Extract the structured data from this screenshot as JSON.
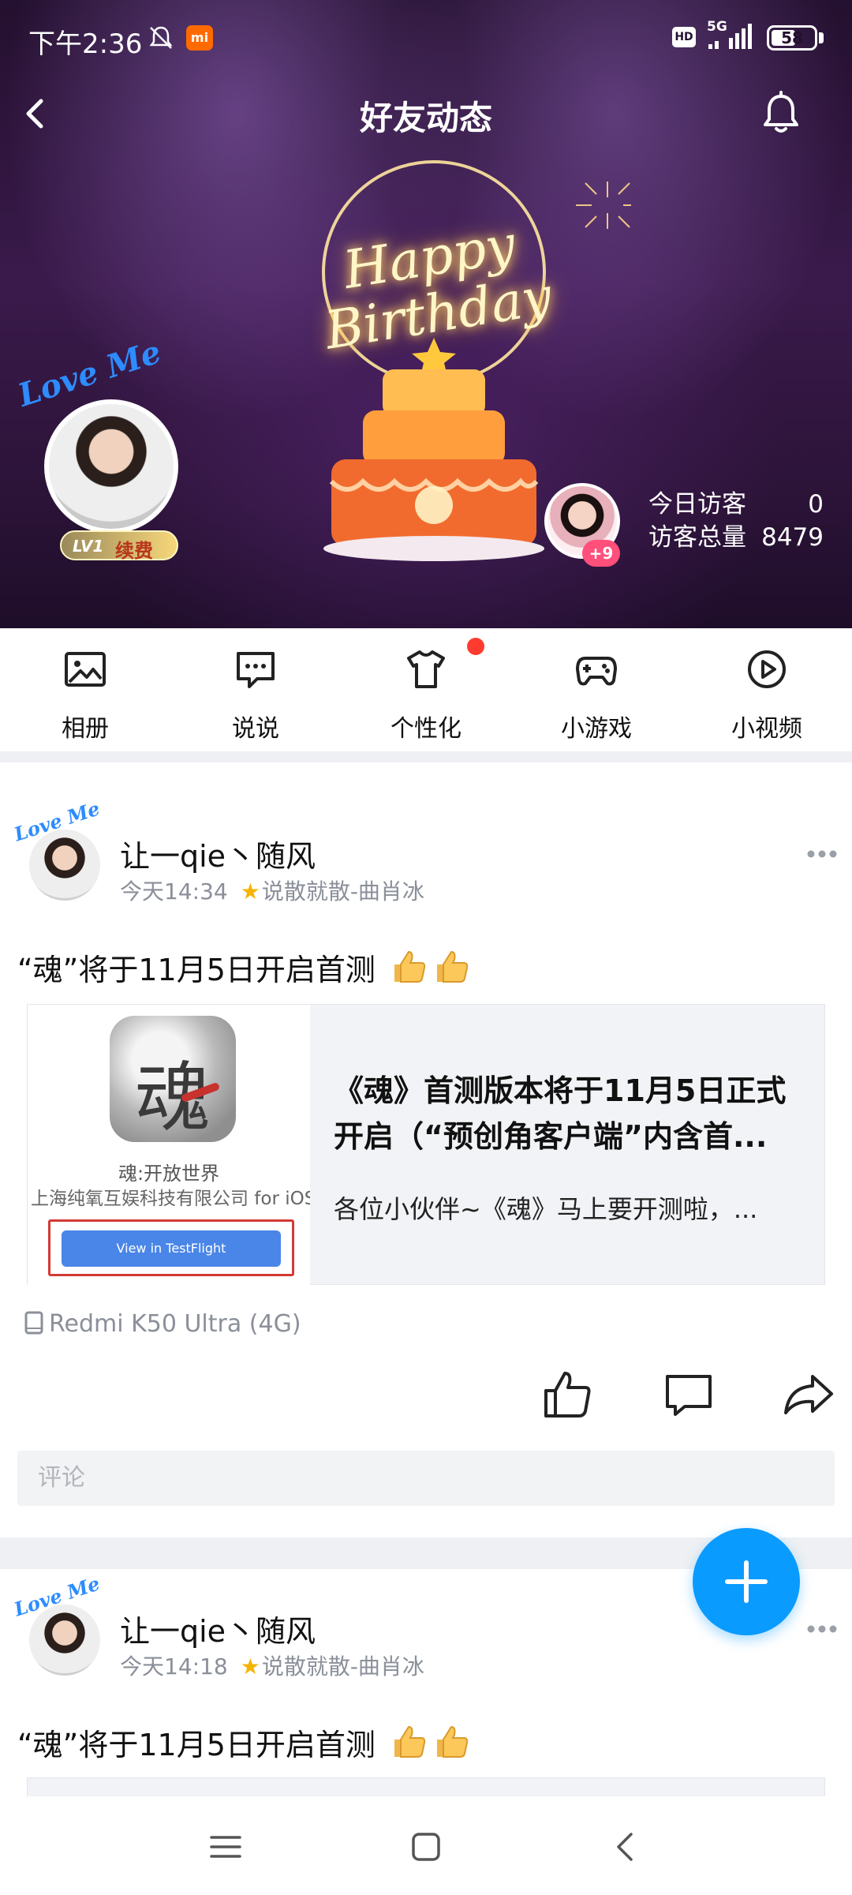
{
  "status_bar": {
    "time": "下午2:36",
    "network": "5G",
    "battery": "58",
    "battery_fraction": 0.58
  },
  "header": {
    "title": "好友动态"
  },
  "hero": {
    "banner_text_line1": "Happy",
    "banner_text_line2": "Birthday",
    "owner_level": "LV1",
    "owner_renew": "续费",
    "owner_tag": "Love Me",
    "visitor_extra": "+9",
    "stats": {
      "today_label": "今日访客",
      "today_value": "0",
      "total_label": "访客总量",
      "total_value": "8479"
    }
  },
  "shortcuts": [
    {
      "label": "相册",
      "icon": "photo-album-icon"
    },
    {
      "label": "说说",
      "icon": "chat-bubble-icon"
    },
    {
      "label": "个性化",
      "icon": "tshirt-icon"
    },
    {
      "label": "小游戏",
      "icon": "gamepad-icon"
    },
    {
      "label": "小视频",
      "icon": "play-circle-icon"
    }
  ],
  "posts": [
    {
      "author": "让一qie丶随风",
      "time": "今天14:34",
      "mood": "说散就散-曲肖冰",
      "text": "“魂”将于11月5日开启首测",
      "card": {
        "icon_char": "魂",
        "app_name": "魂:开放世界",
        "company": "上海纯氧互娱科技有限公司 for iOS",
        "button": "View in TestFlight",
        "title": "《魂》首测版本将于11月5日正式开启（“预创角客户端”内含首...",
        "desc": "各位小伙伴~《魂》马上要开测啦，..."
      },
      "device": "Redmi K50 Ultra (4G)",
      "comment_placeholder": "评论"
    },
    {
      "author": "让一qie丶随风",
      "time": "今天14:18",
      "mood": "说散就散-曲肖冰",
      "text": "“魂”将于11月5日开启首测"
    }
  ],
  "colors": {
    "accent": "#0a9bff",
    "badge_red": "#ff3b30",
    "meta_gray": "#8a8f99"
  }
}
